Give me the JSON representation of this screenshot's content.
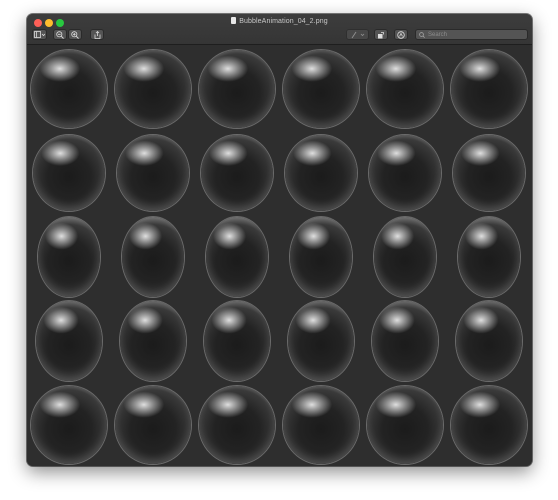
{
  "window": {
    "title": "BubbleAnimation_04_2.png"
  },
  "toolbar": {
    "sidebar_icon": "sidebar-toggle-icon",
    "zoom_out_icon": "zoom-out-icon",
    "zoom_in_icon": "zoom-in-icon",
    "share_icon": "share-icon",
    "markup_icon": "pen-markup-icon",
    "rotate_icon": "rotate-icon",
    "annotate_icon": "annotate-circle-icon",
    "search_placeholder": "Search"
  },
  "image": {
    "rows": 5,
    "columns": 6,
    "content": "bubble animation frames"
  },
  "colors": {
    "window_bg": "#2d2d2d",
    "titlebar": "#383838",
    "close": "#fe5f57",
    "minimize": "#febc2e",
    "maximize": "#28c840"
  }
}
